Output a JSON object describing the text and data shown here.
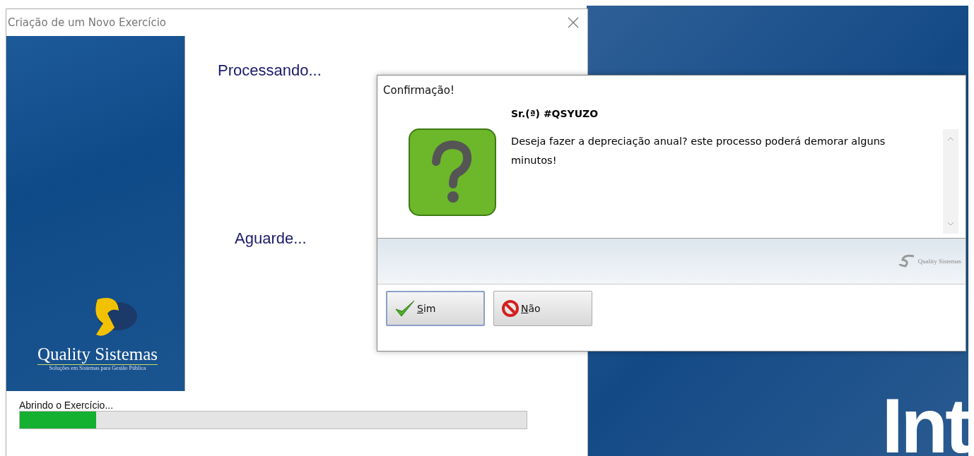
{
  "background_app": {
    "big_text": "Int"
  },
  "main_window": {
    "title": "Criação de um Novo Exercício",
    "brand": {
      "name": "Quality Sistemas",
      "tagline": "Soluções em Sistemas para Gestão Pública"
    },
    "status_top": "Processando...",
    "status_bottom": "Aguarde...",
    "progress": {
      "label": "Abrindo o Exercício...",
      "level": 0.15
    }
  },
  "dialog": {
    "title": "Confirmação!",
    "greeting": "Sr.(ª) #QSYUZO",
    "message": "Deseja fazer a depreciação anual? este processo poderá demorar alguns minutos!",
    "footer_brand": "Quality Sistemas",
    "buttons": [
      {
        "kind": "confirm",
        "label": "Sim",
        "selected": true
      },
      {
        "kind": "cancel",
        "label": "Não",
        "selected": false
      }
    ]
  }
}
